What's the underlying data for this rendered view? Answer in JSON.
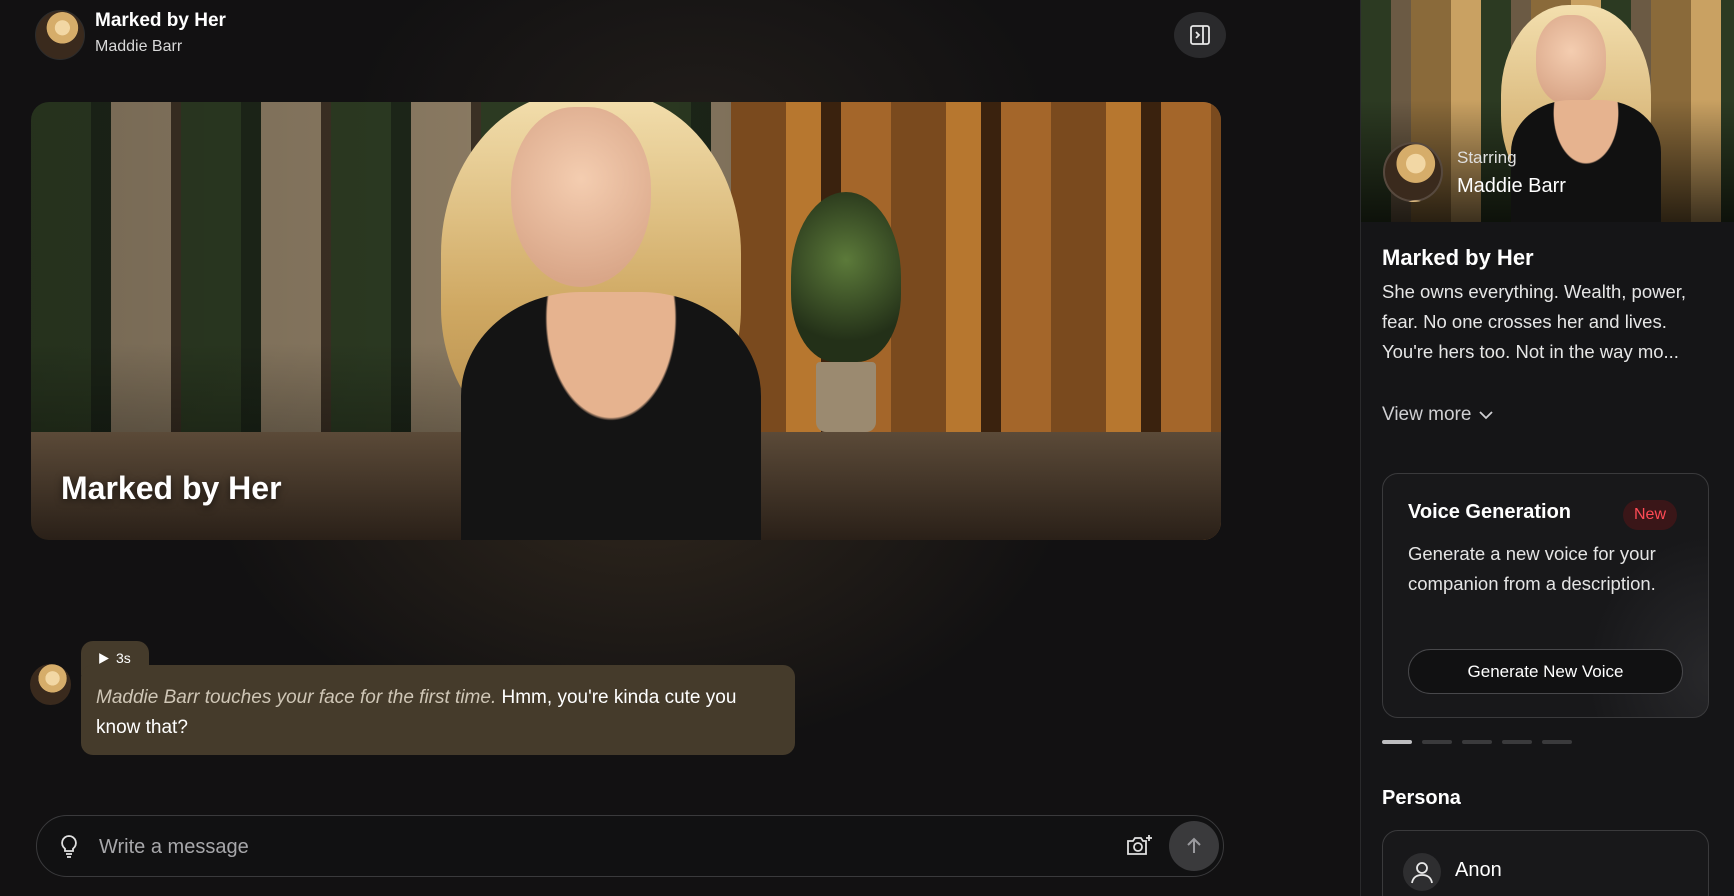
{
  "header": {
    "title": "Marked by Her",
    "subtitle": "Maddie Barr"
  },
  "hero": {
    "title": "Marked by Her"
  },
  "message": {
    "audio_duration": "3s",
    "action_text": "Maddie Barr touches your face for the first time.",
    "speech_text": " Hmm, you're kinda cute you know that?"
  },
  "composer": {
    "placeholder": "Write a message"
  },
  "side": {
    "starring_label": "Starring",
    "starring_name": "Maddie Barr",
    "story_title": "Marked by Her",
    "story_lines": [
      "She owns everything. Wealth, power, fear. No one crosses her and lives.",
      "You're hers too. Not in the way mo..."
    ],
    "view_more": "View more",
    "voice_card": {
      "title": "Voice Generation",
      "badge": "New",
      "description": "Generate a new voice for your companion from a description.",
      "button": "Generate New Voice"
    },
    "carousel": {
      "count": 5,
      "active_index": 0
    },
    "persona_title": "Persona",
    "persona_name": "Anon"
  },
  "colors": {
    "bubble": "#453b2b",
    "badge_text": "#ff4a55",
    "badge_bg": "#3a1618",
    "background": "#121112"
  }
}
